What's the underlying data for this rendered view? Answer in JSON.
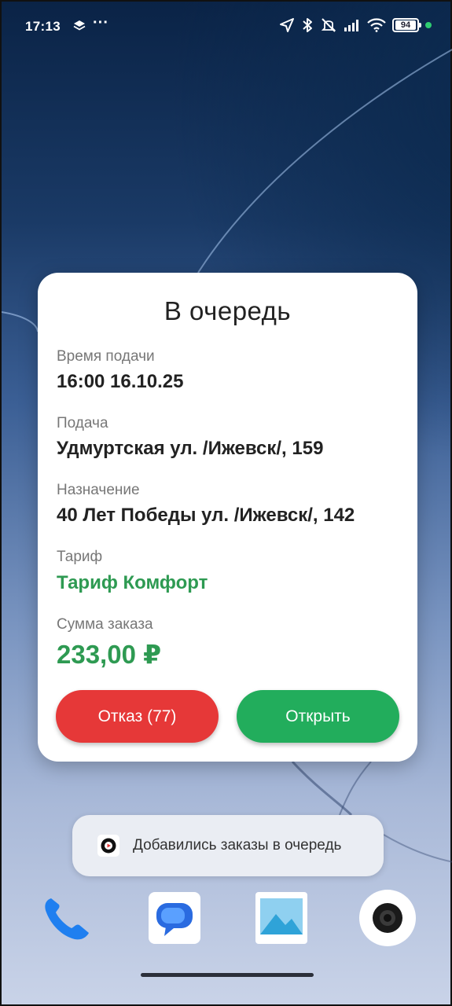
{
  "status_bar": {
    "time": "17:13",
    "more": "···",
    "battery": "94"
  },
  "dialog": {
    "title": "В очередь",
    "fields": [
      {
        "label": "Время подачи",
        "value": "16:00 16.10.25"
      },
      {
        "label": "Подача",
        "value": "Удмуртская ул. /Ижевск/, 159"
      },
      {
        "label": "Назначение",
        "value": "40 Лет Победы ул. /Ижевск/, 142"
      },
      {
        "label": "Тариф",
        "value": "Тариф Комфорт"
      },
      {
        "label": "Сумма заказа",
        "value": "233,00 ₽"
      }
    ],
    "decline_button": "Отказ (77)",
    "open_button": "Открыть"
  },
  "toast": {
    "text": "Добавились заказы в очередь"
  },
  "colors": {
    "accent_green": "#2e9a52",
    "decline_red": "#e63838",
    "open_green": "#22ad5c"
  }
}
